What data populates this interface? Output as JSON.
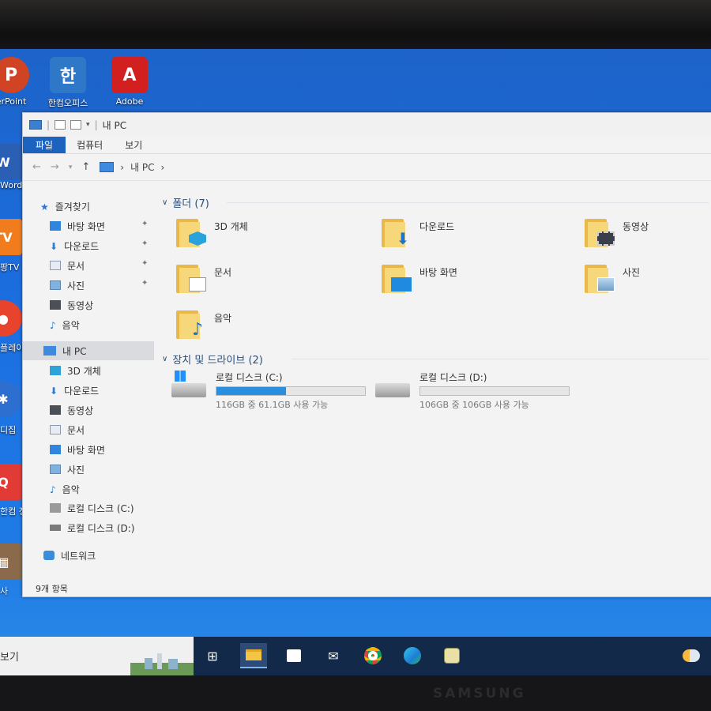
{
  "desktop": {
    "icons_top": [
      {
        "label": "erPoint",
        "icon": "powerpoint-icon",
        "glyph": "P",
        "color": "#d04423"
      },
      {
        "label": "한컴오피스",
        "icon": "hancom-office-icon",
        "glyph": "한",
        "color": "#2e78c7"
      },
      {
        "label": "Adobe",
        "icon": "adobe-acrobat-icon",
        "glyph": "A",
        "color": "#d21f1f"
      }
    ],
    "icons_side": [
      {
        "label": "Word",
        "icon": "word-icon",
        "glyph": "W",
        "color": "#2b5fb3"
      },
      {
        "label": "팡TV",
        "icon": "tv-app-icon",
        "glyph": "TV",
        "color": "#f07c1e"
      },
      {
        "label": "플레이",
        "icon": "player-icon",
        "glyph": "●",
        "color": "#e8432c"
      },
      {
        "label": "디집",
        "icon": "shortcut-app-icon",
        "glyph": "✱",
        "color": "#2c6fd1"
      },
      {
        "label": "한컴 정보",
        "icon": "hancom-info-icon",
        "glyph": "Q",
        "color": "#e23a35"
      },
      {
        "label": "사",
        "icon": "misc-app-icon",
        "glyph": "▦",
        "color": "#8a6a4a"
      }
    ]
  },
  "window": {
    "title": "내 PC",
    "ribbon_tabs": [
      "파일",
      "컴퓨터",
      "보기"
    ],
    "breadcrumb": [
      "내 PC"
    ],
    "nav": {
      "items": [
        {
          "label": "즐겨찾기",
          "icon": "star-icon",
          "pinned": false
        },
        {
          "label": "바탕 화면",
          "icon": "desktop-icon",
          "pinned": true
        },
        {
          "label": "다운로드",
          "icon": "download-icon",
          "pinned": true
        },
        {
          "label": "문서",
          "icon": "documents-icon",
          "pinned": true
        },
        {
          "label": "사진",
          "icon": "pictures-icon",
          "pinned": true
        },
        {
          "label": "동영상",
          "icon": "videos-icon",
          "pinned": false
        },
        {
          "label": "음악",
          "icon": "music-icon",
          "pinned": false
        },
        {
          "label": "내 PC",
          "icon": "pc-icon",
          "pinned": false,
          "selected": true
        },
        {
          "label": "3D 개체",
          "icon": "3d-objects-icon",
          "pinned": false
        },
        {
          "label": "다운로드",
          "icon": "download-icon",
          "pinned": false
        },
        {
          "label": "동영상",
          "icon": "videos-icon",
          "pinned": false
        },
        {
          "label": "문서",
          "icon": "documents-icon",
          "pinned": false
        },
        {
          "label": "바탕 화면",
          "icon": "desktop-icon",
          "pinned": false
        },
        {
          "label": "사진",
          "icon": "pictures-icon",
          "pinned": false
        },
        {
          "label": "음악",
          "icon": "music-icon",
          "pinned": false
        },
        {
          "label": "로컬 디스크 (C:)",
          "icon": "drive-c-icon",
          "pinned": false
        },
        {
          "label": "로컬 디스크 (D:)",
          "icon": "drive-d-icon",
          "pinned": false
        },
        {
          "label": "네트워크",
          "icon": "network-icon",
          "pinned": false
        }
      ]
    },
    "folders_group": "폴더 (7)",
    "folders": [
      {
        "label": "3D 개체",
        "icon": "3d-objects-folder-icon"
      },
      {
        "label": "다운로드",
        "icon": "downloads-folder-icon"
      },
      {
        "label": "동영상",
        "icon": "videos-folder-icon"
      },
      {
        "label": "문서",
        "icon": "documents-folder-icon"
      },
      {
        "label": "바탕 화면",
        "icon": "desktop-folder-icon"
      },
      {
        "label": "사진",
        "icon": "pictures-folder-icon"
      },
      {
        "label": "음악",
        "icon": "music-folder-icon"
      }
    ],
    "drives_group": "장치 및 드라이브 (2)",
    "drives": [
      {
        "label": "로컬 디스크 (C:)",
        "usage": "116GB 중 61.1GB 사용 가능",
        "used_fraction": 0.47,
        "system": true
      },
      {
        "label": "로컬 디스크 (D:)",
        "usage": "106GB 중 106GB 사용 가능",
        "used_fraction": 0.0,
        "system": false
      }
    ],
    "status": "9개 항목"
  },
  "taskbar": {
    "search_text": "보기",
    "buttons": [
      {
        "icon": "task-view-icon",
        "glyph": "⊞"
      },
      {
        "icon": "file-explorer-icon",
        "glyph": "▬",
        "active": true
      },
      {
        "icon": "store-icon",
        "glyph": "▣"
      },
      {
        "icon": "mail-icon",
        "glyph": "✉"
      },
      {
        "icon": "chrome-icon",
        "glyph": "◉"
      },
      {
        "icon": "edge-icon",
        "glyph": "◐"
      },
      {
        "icon": "game-app-icon",
        "glyph": "☻"
      }
    ],
    "weather_icon": "weather-icon"
  },
  "monitor": {
    "brand": "SAMSUNG"
  }
}
